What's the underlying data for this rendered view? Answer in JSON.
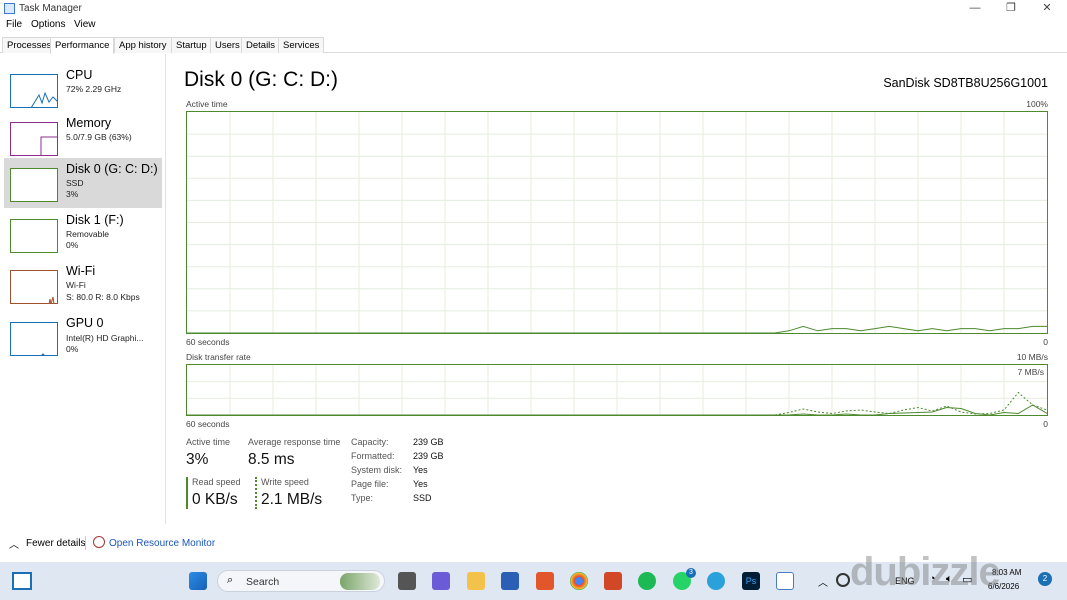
{
  "window": {
    "title": "Task Manager",
    "minimize": "—",
    "maximize": "❐",
    "close": "✕"
  },
  "menu": [
    "File",
    "Options",
    "View"
  ],
  "tabs": [
    "Processes",
    "Performance",
    "App history",
    "Startup",
    "Users",
    "Details",
    "Services"
  ],
  "sidebar": [
    {
      "title": "CPU",
      "sub1": "72%  2.29 GHz",
      "sub2": "",
      "color": "#1a6fb5"
    },
    {
      "title": "Memory",
      "sub1": "5.0/7.9 GB (63%)",
      "sub2": "",
      "color": "#8b2c8f"
    },
    {
      "title": "Disk 0 (G: C: D:)",
      "sub1": "SSD",
      "sub2": "3%",
      "color": "#4c8a2d"
    },
    {
      "title": "Disk 1 (F:)",
      "sub1": "Removable",
      "sub2": "0%",
      "color": "#4c8a2d"
    },
    {
      "title": "Wi-Fi",
      "sub1": "Wi-Fi",
      "sub2": "S: 80.0  R: 8.0 Kbps",
      "color": "#a0522d"
    },
    {
      "title": "GPU 0",
      "sub1": "Intel(R) HD Graphi...",
      "sub2": "0%",
      "color": "#1a6fb5"
    }
  ],
  "main": {
    "title": "Disk 0 (G: C: D:)",
    "model": "SanDisk SD8TB8U256G1001",
    "active_time_label": "Active time",
    "active_time_max": "100%",
    "graph1_left": "60 seconds",
    "graph1_right": "0",
    "transfer_label": "Disk transfer rate",
    "transfer_max": "10 MB/s",
    "transfer_mid": "7 MB/s",
    "graph2_left": "60 seconds",
    "graph2_right": "0"
  },
  "chart_data": [
    {
      "type": "line",
      "title": "Active time",
      "ylim": [
        0,
        100
      ],
      "x": [
        0,
        1,
        2,
        3,
        4,
        5,
        6,
        7,
        8,
        9,
        10,
        11,
        12,
        13,
        14,
        15,
        16,
        17,
        18,
        19,
        20,
        21,
        22,
        23,
        24,
        25,
        26,
        27,
        28,
        29,
        30,
        31,
        32,
        33,
        34,
        35,
        36,
        37,
        38,
        39,
        40,
        41,
        42,
        43,
        44,
        45,
        46,
        47,
        48,
        49,
        50,
        51,
        52,
        53,
        54,
        55,
        56,
        57,
        58,
        59,
        60
      ],
      "series": [
        {
          "values": [
            0,
            0,
            0,
            0,
            0,
            0,
            0,
            0,
            0,
            0,
            0,
            0,
            0,
            0,
            0,
            0,
            0,
            0,
            0,
            0,
            0,
            0,
            0,
            0,
            0,
            0,
            0,
            0,
            0,
            0,
            0,
            0,
            0,
            0,
            0,
            0,
            0,
            0,
            0,
            0,
            0,
            0,
            1,
            3,
            1,
            2,
            2,
            1,
            2,
            3,
            2,
            1,
            2,
            1,
            2,
            2,
            1,
            2,
            2,
            3,
            3
          ]
        }
      ]
    },
    {
      "type": "line",
      "title": "Disk transfer rate",
      "ylim": [
        0,
        10
      ],
      "x": [
        0,
        1,
        2,
        3,
        4,
        5,
        6,
        7,
        8,
        9,
        10,
        11,
        12,
        13,
        14,
        15,
        16,
        17,
        18,
        19,
        20,
        21,
        22,
        23,
        24,
        25,
        26,
        27,
        28,
        29,
        30,
        31,
        32,
        33,
        34,
        35,
        36,
        37,
        38,
        39,
        40,
        41,
        42,
        43,
        44,
        45,
        46,
        47,
        48,
        49,
        50,
        51,
        52,
        53,
        54,
        55,
        56,
        57,
        58,
        59,
        60
      ],
      "series": [
        {
          "name": "Read speed",
          "values": [
            0,
            0,
            0,
            0,
            0,
            0,
            0,
            0,
            0,
            0,
            0,
            0,
            0,
            0,
            0,
            0,
            0,
            0,
            0,
            0,
            0,
            0,
            0,
            0,
            0,
            0,
            0,
            0,
            0,
            0,
            0,
            0,
            0,
            0,
            0,
            0,
            0,
            0,
            0,
            0,
            0,
            0,
            0,
            0.2,
            0,
            0,
            0.2,
            0,
            0,
            0.3,
            0.4,
            0.5,
            0.6,
            1.5,
            1.3,
            0.3,
            0,
            0.5,
            0.3,
            2,
            0.3
          ]
        },
        {
          "name": "Write speed",
          "values": [
            0,
            0,
            0,
            0,
            0,
            0,
            0,
            0,
            0,
            0,
            0,
            0,
            0,
            0,
            0,
            0,
            0,
            0,
            0,
            0,
            0,
            0,
            0,
            0,
            0,
            0,
            0,
            0,
            0,
            0,
            0,
            0,
            0,
            0,
            0,
            0,
            0,
            0,
            0,
            0,
            0,
            0,
            0.5,
            1.2,
            0.6,
            0.3,
            0.8,
            1,
            0.6,
            0.3,
            1,
            1.5,
            0.8,
            1.8,
            0.6,
            0.2,
            0.3,
            1,
            4.5,
            2,
            1
          ]
        }
      ]
    }
  ],
  "stats": {
    "active_time_label": "Active time",
    "active_time": "3%",
    "avg_resp_label": "Average response time",
    "avg_resp": "8.5 ms",
    "read_label": "Read speed",
    "read": "0 KB/s",
    "write_label": "Write speed",
    "write": "2.1 MB/s"
  },
  "info": [
    {
      "label": "Capacity:",
      "value": "239 GB"
    },
    {
      "label": "Formatted:",
      "value": "239 GB"
    },
    {
      "label": "System disk:",
      "value": "Yes"
    },
    {
      "label": "Page file:",
      "value": "Yes"
    },
    {
      "label": "Type:",
      "value": "SSD"
    }
  ],
  "footer": {
    "fewer": "Fewer details",
    "resource": "Open Resource Monitor"
  },
  "taskbar": {
    "search_placeholder": "Search",
    "lang": "ENG",
    "time": "8:03 AM",
    "date": "6/6/2026",
    "notif": "2",
    "whatsapp_badge": "3"
  },
  "watermark": "dubizzle"
}
